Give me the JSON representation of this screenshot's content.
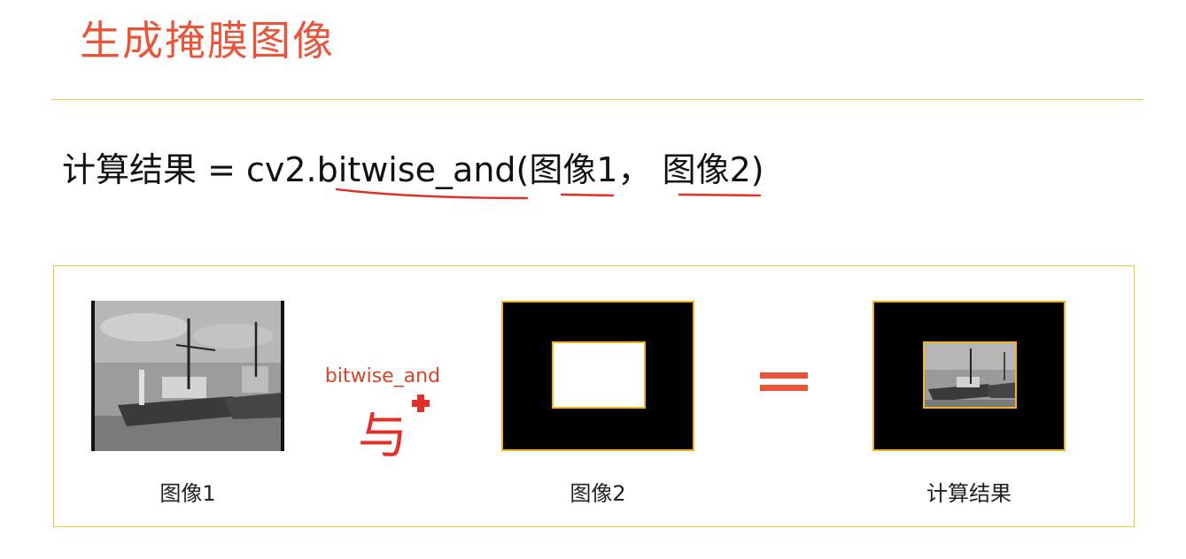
{
  "slide": {
    "title": "生成掩膜图像"
  },
  "formula": {
    "text": "计算结果 = cv2.bitwise_and(图像1， 图像2)"
  },
  "diagram": {
    "operation_label": "bitwise_and",
    "handwritten_note": "与",
    "image1_caption": "图像1",
    "image2_caption": "图像2",
    "result_caption": "计算结果"
  },
  "colors": {
    "title": "#e8553b",
    "accent_border": "#f5c842",
    "image_border": "#f3b21f",
    "annotation_ink": "#e0302a"
  }
}
